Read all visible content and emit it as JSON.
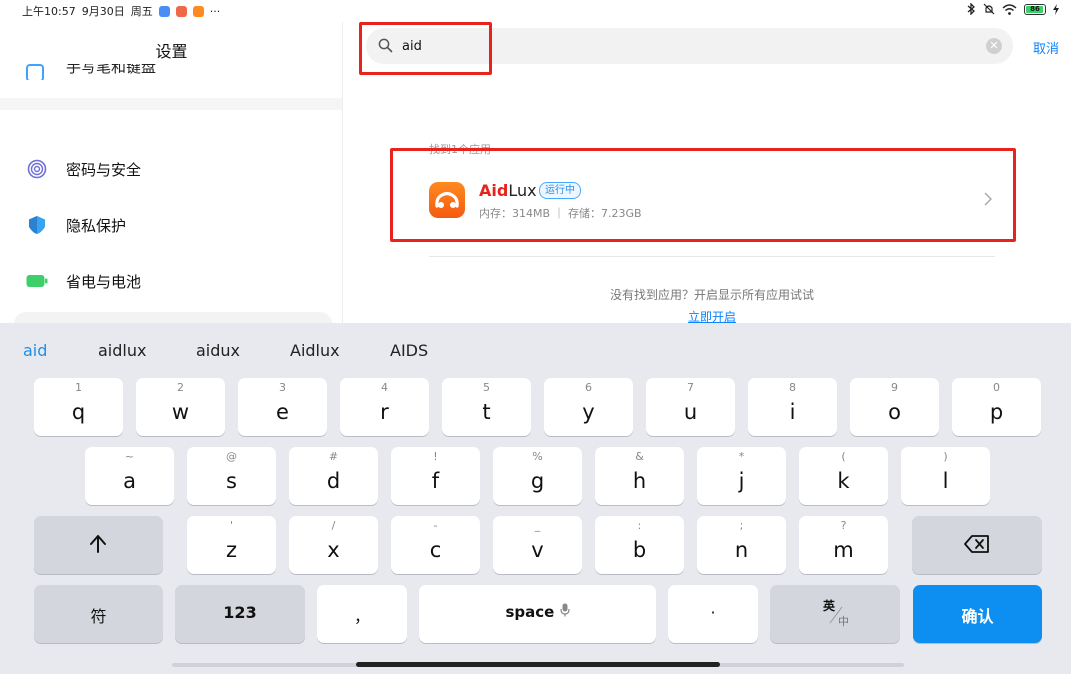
{
  "status_bar": {
    "time": "上午10:57",
    "date": "9月30日",
    "weekday": "周五",
    "more": "···",
    "battery": "86"
  },
  "settings": {
    "title": "设置",
    "partial_item": "手写笔和键盘",
    "items": [
      {
        "label": "密码与安全",
        "icon": "fingerprint-icon",
        "color": "#6f6fd6"
      },
      {
        "label": "隐私保护",
        "icon": "shield-icon",
        "color": "#38a3f0"
      },
      {
        "label": "省电与电池",
        "icon": "battery-icon",
        "color": "#3fcf6a"
      }
    ]
  },
  "search": {
    "value": "aid",
    "placeholder": "",
    "cancel_label": "取消"
  },
  "results": {
    "found_label": "找到1个应用",
    "app": {
      "name_highlight": "Aid",
      "name_rest": "Lux",
      "badge": "运行中",
      "meta": "内存：314MB ｜ 存储：7.23GB"
    },
    "not_found_text": "没有找到应用？开启显示所有应用试试",
    "enable_link": "立即开启"
  },
  "keyboard": {
    "suggestions": [
      "aid",
      "aidlux",
      "aidux",
      "Aidlux",
      "AIDS"
    ],
    "row1": [
      {
        "hint": "1",
        "key": "q"
      },
      {
        "hint": "2",
        "key": "w"
      },
      {
        "hint": "3",
        "key": "e"
      },
      {
        "hint": "4",
        "key": "r"
      },
      {
        "hint": "5",
        "key": "t"
      },
      {
        "hint": "6",
        "key": "y"
      },
      {
        "hint": "7",
        "key": "u"
      },
      {
        "hint": "8",
        "key": "i"
      },
      {
        "hint": "9",
        "key": "o"
      },
      {
        "hint": "0",
        "key": "p"
      }
    ],
    "row2": [
      {
        "hint": "~",
        "key": "a"
      },
      {
        "hint": "@",
        "key": "s"
      },
      {
        "hint": "#",
        "key": "d"
      },
      {
        "hint": "!",
        "key": "f"
      },
      {
        "hint": "%",
        "key": "g"
      },
      {
        "hint": "&",
        "key": "h"
      },
      {
        "hint": "*",
        "key": "j"
      },
      {
        "hint": "(",
        "key": "k"
      },
      {
        "hint": ")",
        "key": "l"
      }
    ],
    "row3": [
      {
        "hint": "'",
        "key": "z"
      },
      {
        "hint": "/",
        "key": "x"
      },
      {
        "hint": "-",
        "key": "c"
      },
      {
        "hint": "_",
        "key": "v"
      },
      {
        "hint": ":",
        "key": "b"
      },
      {
        "hint": ";",
        "key": "n"
      },
      {
        "hint": "?",
        "key": "m"
      }
    ],
    "symbols_label": "符",
    "numbers_label": "123",
    "comma": "，",
    "space_label": "space",
    "period": "·",
    "lang_top": "英",
    "lang_bottom": "中",
    "confirm_label": "确认"
  }
}
